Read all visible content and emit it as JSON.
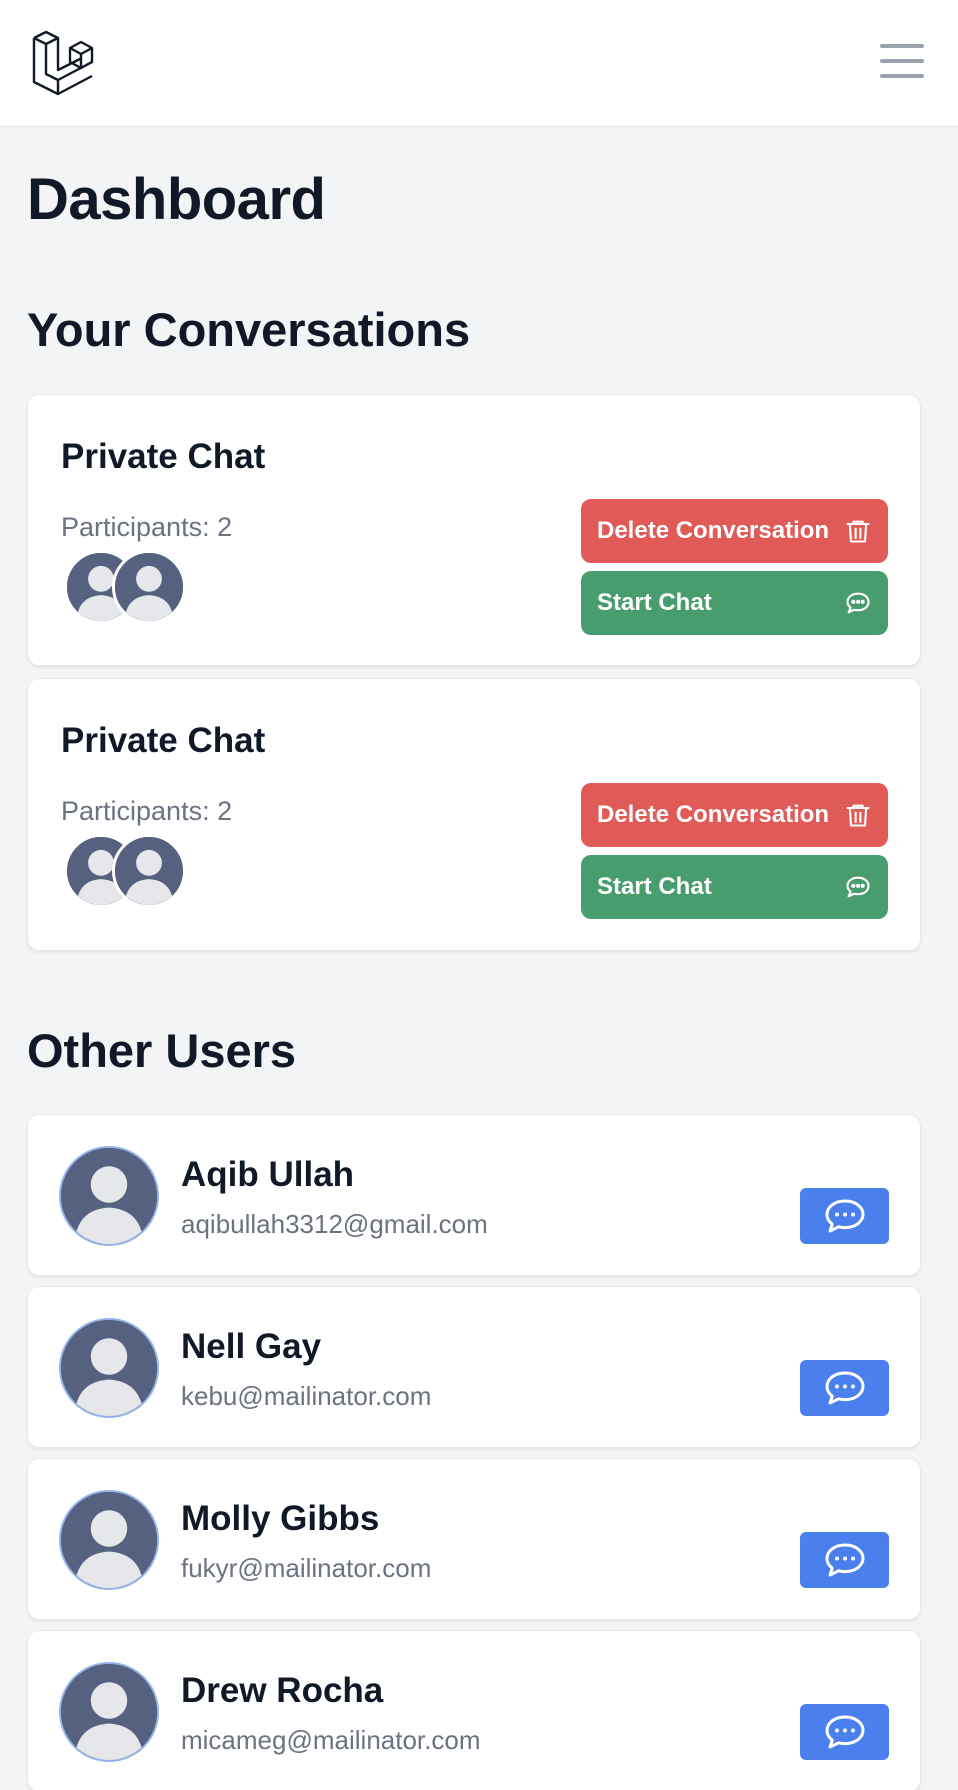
{
  "header": {
    "logo_icon": "laravel-logo-icon",
    "menu_icon": "hamburger-menu-icon"
  },
  "page": {
    "title": "Dashboard"
  },
  "conversations": {
    "title": "Your Conversations",
    "items": [
      {
        "title": "Private Chat",
        "participants": "Participants: 2",
        "delete_label": "Delete Conversation",
        "start_label": "Start Chat"
      },
      {
        "title": "Private Chat",
        "participants": "Participants: 2",
        "delete_label": "Delete Conversation",
        "start_label": "Start Chat"
      }
    ]
  },
  "other_users": {
    "title": "Other Users",
    "items": [
      {
        "name": "Aqib Ullah",
        "email": "aqibullah3312@gmail.com"
      },
      {
        "name": "Nell Gay",
        "email": "kebu@mailinator.com"
      },
      {
        "name": "Molly Gibbs",
        "email": "fukyr@mailinator.com"
      },
      {
        "name": "Drew Rocha",
        "email": "micameg@mailinator.com"
      }
    ]
  },
  "colors": {
    "delete_button": "#e05a58",
    "start_button": "#489d6e",
    "message_button": "#4b7fee",
    "avatar": "#55617e"
  }
}
